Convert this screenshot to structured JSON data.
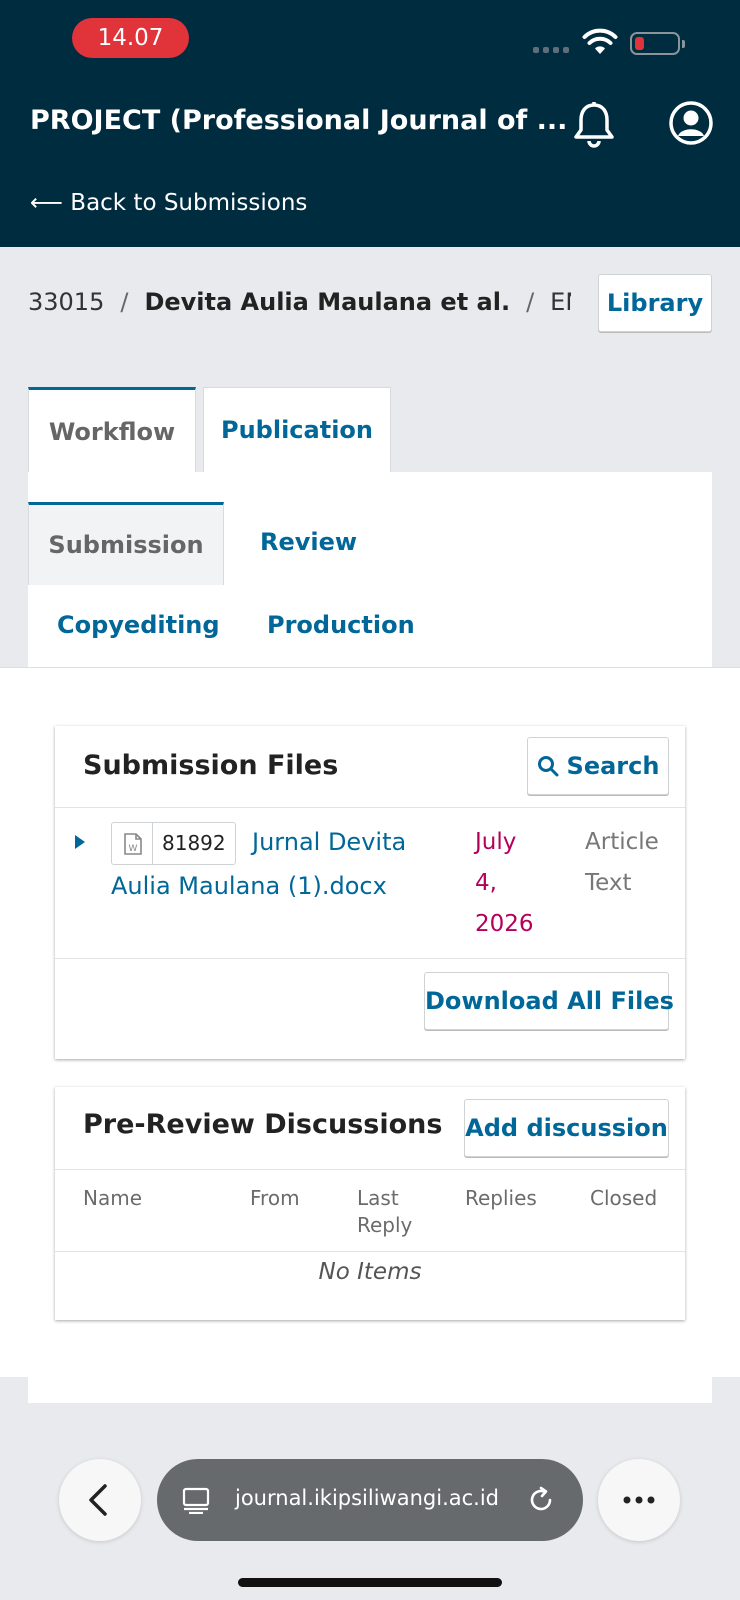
{
  "status_bar": {
    "time": "14.07"
  },
  "header": {
    "journal_title": "PROJECT (Professional Journal of ...",
    "back_link": "⟵ Back to Submissions"
  },
  "breadcrumb": {
    "id": "33015",
    "separator": "/",
    "authors": "Devita Aulia Maulana et al.",
    "title_fragment": "ENGL",
    "library_button": "Library"
  },
  "main_tabs": [
    {
      "label": "Workflow",
      "active": true
    },
    {
      "label": "Publication",
      "active": false
    }
  ],
  "workflow_tabs": [
    {
      "label": "Submission",
      "active": true
    },
    {
      "label": "Review",
      "active": false
    },
    {
      "label": "Copyediting",
      "active": false
    },
    {
      "label": "Production",
      "active": false
    }
  ],
  "submission_files": {
    "title": "Submission Files",
    "search_button": "Search",
    "files": [
      {
        "id": "81892",
        "name_line1": "Jurnal Devita",
        "name_line2": "Aulia Maulana (1).docx",
        "date_lines": [
          "July",
          "4,",
          "2026"
        ],
        "type_lines": [
          "Article",
          "Text"
        ]
      }
    ],
    "download_all_button": "Download All Files"
  },
  "discussions": {
    "title": "Pre-Review Discussions",
    "add_button": "Add discussion",
    "columns": [
      "Name",
      "From",
      "Last Reply",
      "Replies",
      "Closed"
    ],
    "column_lines": {
      "last_reply": [
        "Last",
        "Reply"
      ]
    },
    "empty_text": "No Items"
  },
  "browser": {
    "url": "journal.ikipsiliwangi.ac.id"
  },
  "colors": {
    "header_bg": "#002c40",
    "link_blue": "#006798",
    "date_magenta": "#b5005a",
    "time_pill": "#e0333a"
  },
  "icons": [
    "wifi-icon",
    "battery-icon",
    "bell-icon",
    "user-icon",
    "search-icon",
    "expand-arrow-icon",
    "word-file-icon",
    "back-icon",
    "tab-icon",
    "reload-icon",
    "more-icon"
  ]
}
